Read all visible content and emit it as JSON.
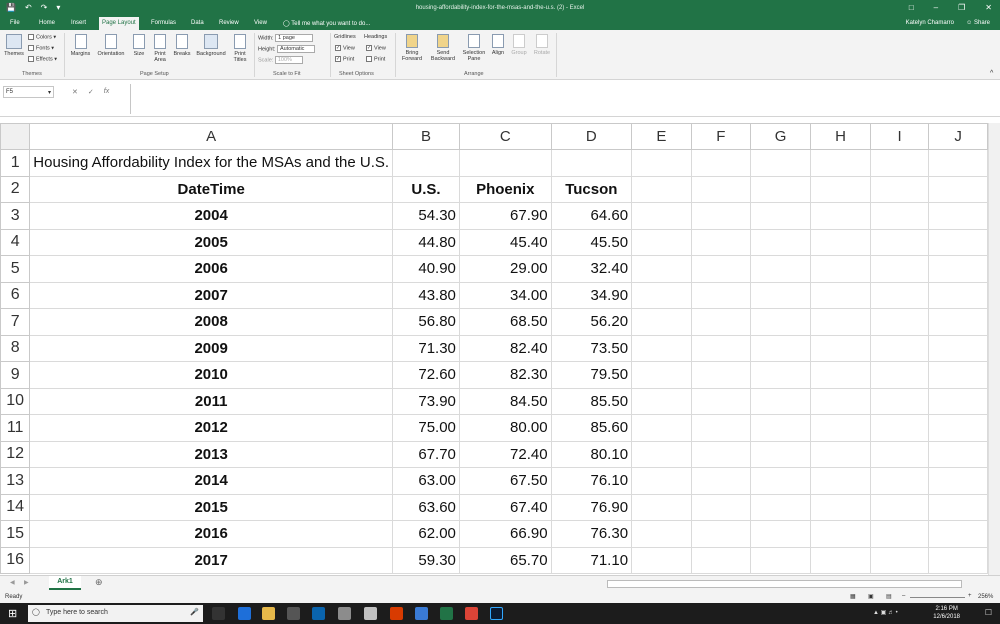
{
  "window": {
    "doc_title": "housing-affordability-index-for-the-msas-and-the-u.s. (2) - Excel",
    "user": "Katelyn Chamarro",
    "share_label": "Share"
  },
  "tabs": [
    "File",
    "Home",
    "Insert",
    "Page Layout",
    "Formulas",
    "Data",
    "Review",
    "View"
  ],
  "tell_me": "Tell me what you want to do...",
  "ribbon": {
    "themes": {
      "themes": "Themes",
      "colors": "Colors",
      "fonts": "Fonts",
      "effects": "Effects",
      "group": "Themes"
    },
    "page_setup": {
      "margins": "Margins",
      "orientation": "Orientation",
      "size": "Size",
      "print_area": "Print Area",
      "breaks": "Breaks",
      "background": "Background",
      "print_titles": "Print Titles",
      "group": "Page Setup"
    },
    "scale": {
      "width_label": "Width:",
      "width_value": "1 page",
      "height_label": "Height:",
      "height_value": "Automatic",
      "scale_label": "Scale:",
      "scale_value": "100%",
      "group": "Scale to Fit"
    },
    "sheet_options": {
      "gridlines": "Gridlines",
      "headings": "Headings",
      "view": "View",
      "print": "Print",
      "group": "Sheet Options"
    },
    "arrange": {
      "bring_forward": "Bring Forward",
      "send_backward": "Send Backward",
      "selection_pane": "Selection Pane",
      "align": "Align",
      "group_btn": "Group",
      "rotate": "Rotate",
      "group": "Arrange"
    }
  },
  "formula_bar": {
    "name_box": "F5",
    "formula": ""
  },
  "columns": [
    "A",
    "B",
    "C",
    "D",
    "E",
    "F",
    "G",
    "H",
    "I",
    "J"
  ],
  "sheet": {
    "title": "Housing Affordability Index for the MSAs and the U.S.",
    "headers": [
      "DateTime",
      "U.S.",
      "Phoenix",
      "Tucson"
    ],
    "rows": [
      [
        "2004",
        "54.30",
        "67.90",
        "64.60"
      ],
      [
        "2005",
        "44.80",
        "45.40",
        "45.50"
      ],
      [
        "2006",
        "40.90",
        "29.00",
        "32.40"
      ],
      [
        "2007",
        "43.80",
        "34.00",
        "34.90"
      ],
      [
        "2008",
        "56.80",
        "68.50",
        "56.20"
      ],
      [
        "2009",
        "71.30",
        "82.40",
        "73.50"
      ],
      [
        "2010",
        "72.60",
        "82.30",
        "79.50"
      ],
      [
        "2011",
        "73.90",
        "84.50",
        "85.50"
      ],
      [
        "2012",
        "75.00",
        "80.00",
        "85.60"
      ],
      [
        "2013",
        "67.70",
        "72.40",
        "80.10"
      ],
      [
        "2014",
        "63.00",
        "67.50",
        "76.10"
      ],
      [
        "2015",
        "63.60",
        "67.40",
        "76.90"
      ],
      [
        "2016",
        "62.00",
        "66.90",
        "76.30"
      ],
      [
        "2017",
        "59.30",
        "65.70",
        "71.10"
      ]
    ]
  },
  "sheet_tab": "Ark1",
  "status": {
    "ready": "Ready",
    "zoom": "256%"
  },
  "taskbar": {
    "search_placeholder": "Type here to search",
    "time": "2:16 PM",
    "date": "12/6/2018"
  },
  "colors": {
    "excel_green": "#217346",
    "taskbar": "#1c1c1c"
  }
}
